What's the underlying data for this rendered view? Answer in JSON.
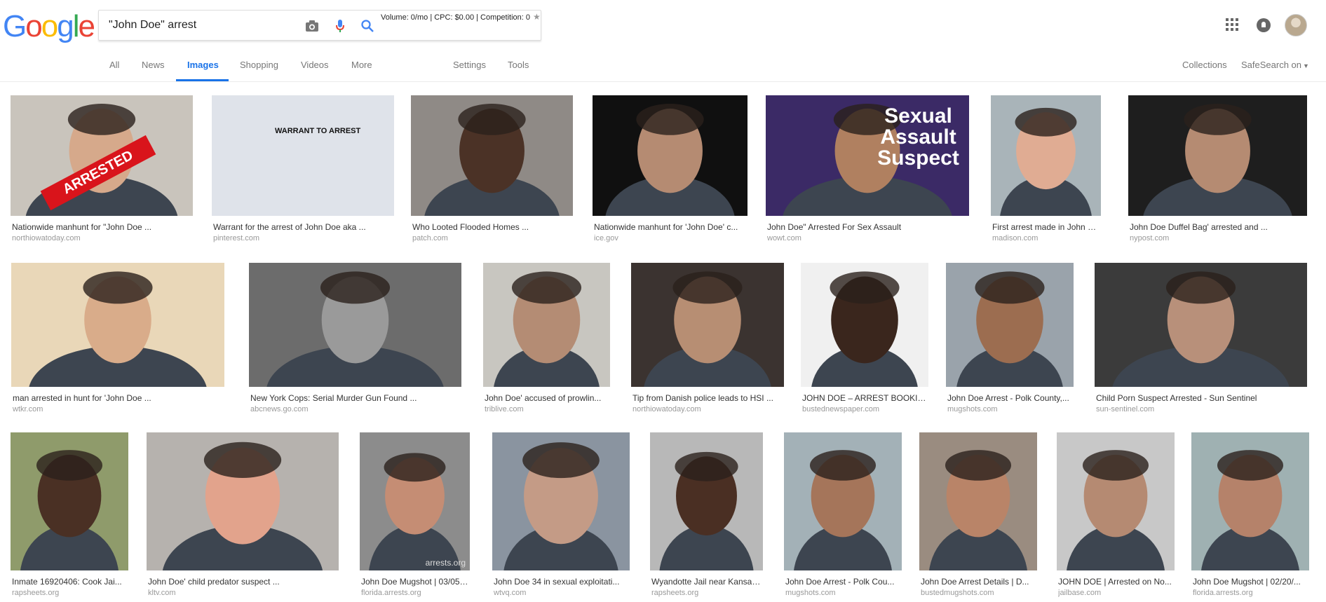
{
  "logo": {
    "letters": [
      "G",
      "o",
      "o",
      "g",
      "l",
      "e"
    ],
    "colors": [
      "#4285F4",
      "#EA4335",
      "#FBBC05",
      "#4285F4",
      "#34A853",
      "#EA4335"
    ]
  },
  "search": {
    "query": "\"John Doe\" arrest",
    "seo_bar": "Volume: 0/mo | CPC: $0.00 | Competition: 0"
  },
  "tabs": [
    "All",
    "News",
    "Images",
    "Shopping",
    "Videos",
    "More",
    "Settings",
    "Tools",
    "Collections",
    "SafeSearch on"
  ],
  "accent": "#1a73e8",
  "rows": [
    [
      {
        "caption": "Nationwide manhunt for \"John Doe ...",
        "domain": "northiowatoday.com",
        "bg": "#c9c4bc",
        "skin": "#d6a98b",
        "overlay": "ARRESTED"
      },
      {
        "caption": "Warrant for the arrest of John Doe aka ...",
        "domain": "pinterest.com",
        "bg": "#dfe3ea",
        "skin": "",
        "overlay": "WARRANT TO ARREST"
      },
      {
        "caption": "Who Looted Flooded Homes ...",
        "domain": "patch.com",
        "bg": "#8f8a86",
        "skin": "#4b3226",
        "overlay": ""
      },
      {
        "caption": "Nationwide manhunt for 'John Doe' c...",
        "domain": "ice.gov",
        "bg": "#101010",
        "skin": "#b58b72",
        "overlay": ""
      },
      {
        "caption": "John Doe\" Arrested For Sex Assault",
        "domain": "wowt.com",
        "bg": "#3b2a66",
        "skin": "#b08060",
        "overlay": "Sexual Assault Suspect"
      },
      {
        "caption": "First arrest made in John Do...",
        "domain": "madison.com",
        "bg": "#a9b4b9",
        "skin": "#e0ac93",
        "overlay": ""
      },
      {
        "caption": "John Doe Duffel Bag' arrested and ...",
        "domain": "nypost.com",
        "bg": "#1e1e1e",
        "skin": "#b58b72",
        "overlay": ""
      }
    ],
    [
      {
        "caption": "man arrested in hunt for 'John Doe ...",
        "domain": "wtkr.com",
        "bg": "#e9d7b8",
        "skin": "#d9ac8a",
        "overlay": ""
      },
      {
        "caption": "New York Cops: Serial Murder Gun Found ...",
        "domain": "abcnews.go.com",
        "bg": "#6c6c6c",
        "skin": "#9a9a9a",
        "overlay": ""
      },
      {
        "caption": "John Doe' accused of prowlin...",
        "domain": "triblive.com",
        "bg": "#c8c6c0",
        "skin": "#b48c74",
        "overlay": ""
      },
      {
        "caption": "Tip from Danish police leads to HSI ...",
        "domain": "northiowatoday.com",
        "bg": "#3b3330",
        "skin": "#b78e73",
        "overlay": ""
      },
      {
        "caption": "JOHN DOE – ARREST BOOKIN...",
        "domain": "bustednewspaper.com",
        "bg": "#f0f0f0",
        "skin": "#3a261d",
        "overlay": ""
      },
      {
        "caption": "John Doe Arrest - Polk County,...",
        "domain": "mugshots.com",
        "bg": "#9aa3ab",
        "skin": "#9c6d50",
        "overlay": ""
      },
      {
        "caption": "Child Porn Suspect Arrested - Sun Sentinel",
        "domain": "sun-sentinel.com",
        "bg": "#3b3b3b",
        "skin": "#b8907a",
        "overlay": ""
      }
    ],
    [
      {
        "caption": "Inmate 16920406: Cook Jai...",
        "domain": "rapsheets.org",
        "bg": "#8f9b6b",
        "skin": "#4a3024",
        "overlay": ""
      },
      {
        "caption": "John Doe' child predator suspect ...",
        "domain": "kltv.com",
        "bg": "#b6b2ae",
        "skin": "#e2a38c",
        "overlay": ""
      },
      {
        "caption": "John Doe Mugshot | 03/05/...",
        "domain": "florida.arrests.org",
        "bg": "#8c8c8c",
        "skin": "#c58d74",
        "overlay": "arrests.org"
      },
      {
        "caption": "John Doe 34 in sexual exploitati...",
        "domain": "wtvq.com",
        "bg": "#8a94a0",
        "skin": "#c49b86",
        "overlay": ""
      },
      {
        "caption": "Wyandotte Jail near Kansas...",
        "domain": "rapsheets.org",
        "bg": "#b8b8b8",
        "skin": "#4a2f23",
        "overlay": ""
      },
      {
        "caption": "John Doe Arrest - Polk Cou...",
        "domain": "mugshots.com",
        "bg": "#a3b1b7",
        "skin": "#a5755a",
        "overlay": ""
      },
      {
        "caption": "John Doe Arrest Details | D...",
        "domain": "bustedmugshots.com",
        "bg": "#9a8c80",
        "skin": "#b98468",
        "overlay": ""
      },
      {
        "caption": "JOHN DOE | Arrested on No...",
        "domain": "jailbase.com",
        "bg": "#c8c8c8",
        "skin": "#b58a72",
        "overlay": ""
      },
      {
        "caption": "John Doe Mugshot | 02/20/...",
        "domain": "florida.arrests.org",
        "bg": "#9fb1b2",
        "skin": "#b5826a",
        "overlay": ""
      }
    ]
  ]
}
